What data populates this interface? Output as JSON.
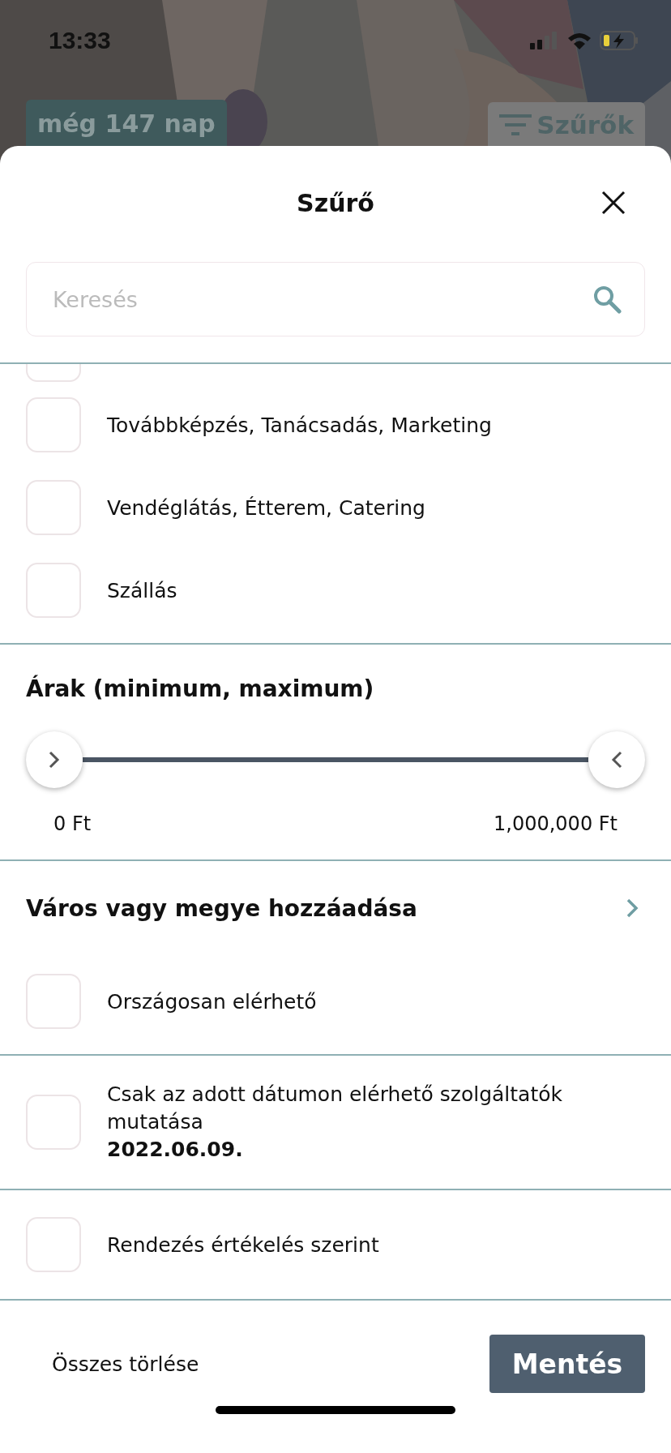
{
  "status_bar": {
    "time": "13:33"
  },
  "background": {
    "days_badge": "még 147 nap",
    "filters_button": "Szűrők"
  },
  "sheet": {
    "title": "Szűrő",
    "search": {
      "placeholder": "Keresés"
    },
    "categories": [
      {
        "checked": false,
        "kind": "partial"
      },
      {
        "label": "Továbbképzés, Tanácsadás, Marketing",
        "checked": false,
        "kind": "full"
      },
      {
        "label": "Vendéglátás, Étterem, Catering",
        "checked": false,
        "kind": "full"
      },
      {
        "label": "Szállás",
        "checked": false,
        "kind": "full"
      }
    ],
    "price": {
      "title": "Árak (minimum, maximum)",
      "min_label": "0 Ft",
      "max_label": "1,000,000 Ft"
    },
    "location": {
      "title": "Város vagy megye hozzáadása",
      "nationwide": {
        "label": "Országosan elérhető",
        "checked": false
      }
    },
    "date_filter": {
      "label": "Csak az adott dátumon elérhető szolgáltatók mutatása",
      "date": "2022.06.09.",
      "checked": false
    },
    "sort_by_rating": {
      "label": "Rendezés értékelés szerint",
      "checked": false
    },
    "footer": {
      "clear": "Összes törlése",
      "save": "Mentés"
    }
  }
}
